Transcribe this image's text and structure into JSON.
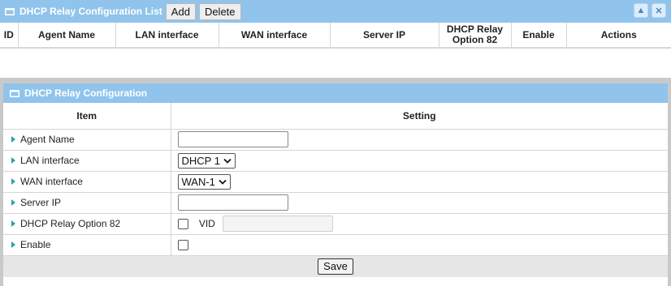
{
  "list_panel": {
    "title": "DHCP Relay Configuration List",
    "add_label": "Add",
    "delete_label": "Delete",
    "minimize_glyph": "▲",
    "close_glyph": "✕",
    "columns": [
      "ID",
      "Agent Name",
      "LAN interface",
      "WAN interface",
      "Server IP",
      "DHCP Relay Option 82",
      "Enable",
      "Actions"
    ],
    "rows": []
  },
  "config_panel": {
    "title": "DHCP Relay Configuration",
    "col_item": "Item",
    "col_setting": "Setting",
    "rows": {
      "agent_name": {
        "label": "Agent Name",
        "value": ""
      },
      "lan_interface": {
        "label": "LAN interface",
        "selected": "DHCP 1"
      },
      "wan_interface": {
        "label": "WAN interface",
        "selected": "WAN-1"
      },
      "server_ip": {
        "label": "Server IP",
        "value": ""
      },
      "option82": {
        "label": "DHCP Relay Option 82",
        "checked": false,
        "vid_label": "VID",
        "vid_value": ""
      },
      "enable": {
        "label": "Enable",
        "checked": false
      }
    },
    "save_label": "Save"
  },
  "colors": {
    "header_blue": "#90c4ec",
    "arrow_teal": "#2aa0a8",
    "frame_gray": "#c9c9c9"
  },
  "icons": {
    "panel_header_icon": "window-icon",
    "row_marker": "triangle-right-icon",
    "select_indicator": "chevron-down-icon"
  }
}
